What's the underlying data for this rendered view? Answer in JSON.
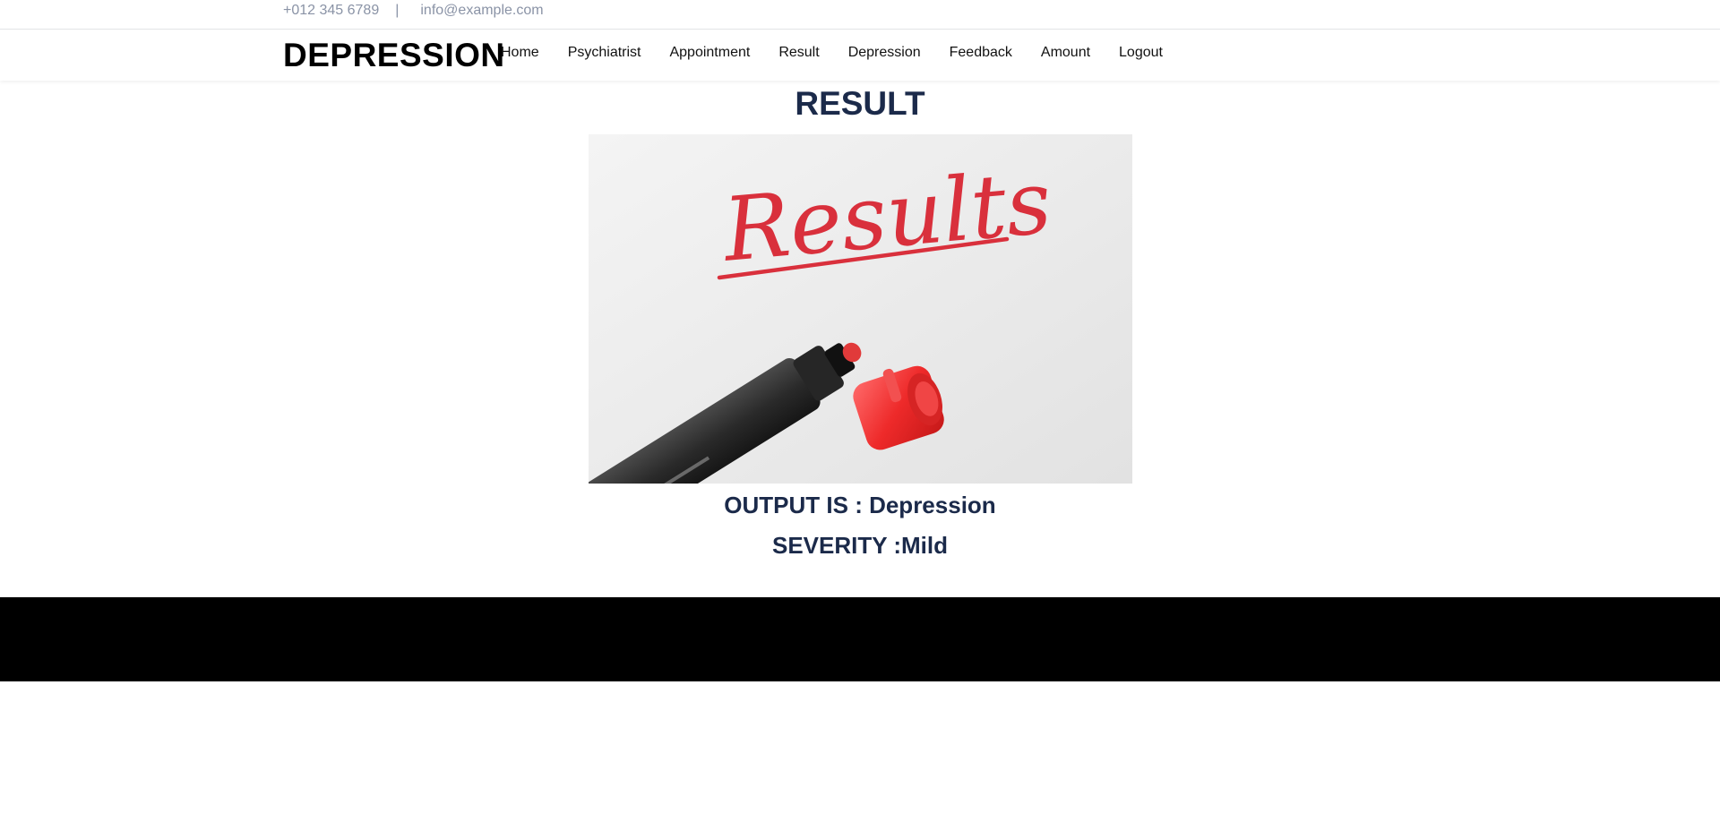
{
  "topbar": {
    "phone": "+012 345 6789",
    "separator": "|",
    "email": "info@example.com"
  },
  "navbar": {
    "brand": "DEPRESSION",
    "links": [
      {
        "label": "Home"
      },
      {
        "label": "Psychiatrist"
      },
      {
        "label": "Appointment"
      },
      {
        "label": "Result"
      },
      {
        "label": "Depression"
      },
      {
        "label": "Feedback"
      },
      {
        "label": "Amount"
      },
      {
        "label": "Logout"
      }
    ]
  },
  "main": {
    "heading": "RESULT",
    "image": {
      "handwritten_text": "Results",
      "accent_color": "#d9303c"
    },
    "output_line": "OUTPUT IS : Depression",
    "severity_line": "SEVERITY :Mild"
  },
  "colors": {
    "heading": "#1b2a4a",
    "topbar_text": "#8a93a6",
    "footer": "#000000"
  }
}
